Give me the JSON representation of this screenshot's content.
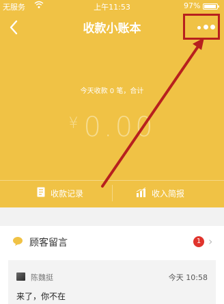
{
  "status_bar": {
    "carrier": "无服务",
    "time": "上午11:53",
    "battery": "97%"
  },
  "nav": {
    "title": "收款小账本",
    "back_icon": "chevron-left-icon",
    "more_icon": "more-dots-icon"
  },
  "summary": {
    "text": "今天收款 0 笔，合计",
    "currency": "¥",
    "amount": "0.00"
  },
  "actions": [
    {
      "label": "收款记录",
      "icon": "receipt-icon"
    },
    {
      "label": "收入简报",
      "icon": "bar-chart-icon"
    }
  ],
  "messages_section": {
    "title": "顾客留言",
    "badge_count": "1",
    "icon": "chat-bubble-icon"
  },
  "message": {
    "sender": "陈魏挺",
    "time": "今天 10:58",
    "text": "来了，你不在"
  },
  "colors": {
    "accent": "#f0c245",
    "annotation": "#b7201e",
    "badge": "#e0342d"
  }
}
